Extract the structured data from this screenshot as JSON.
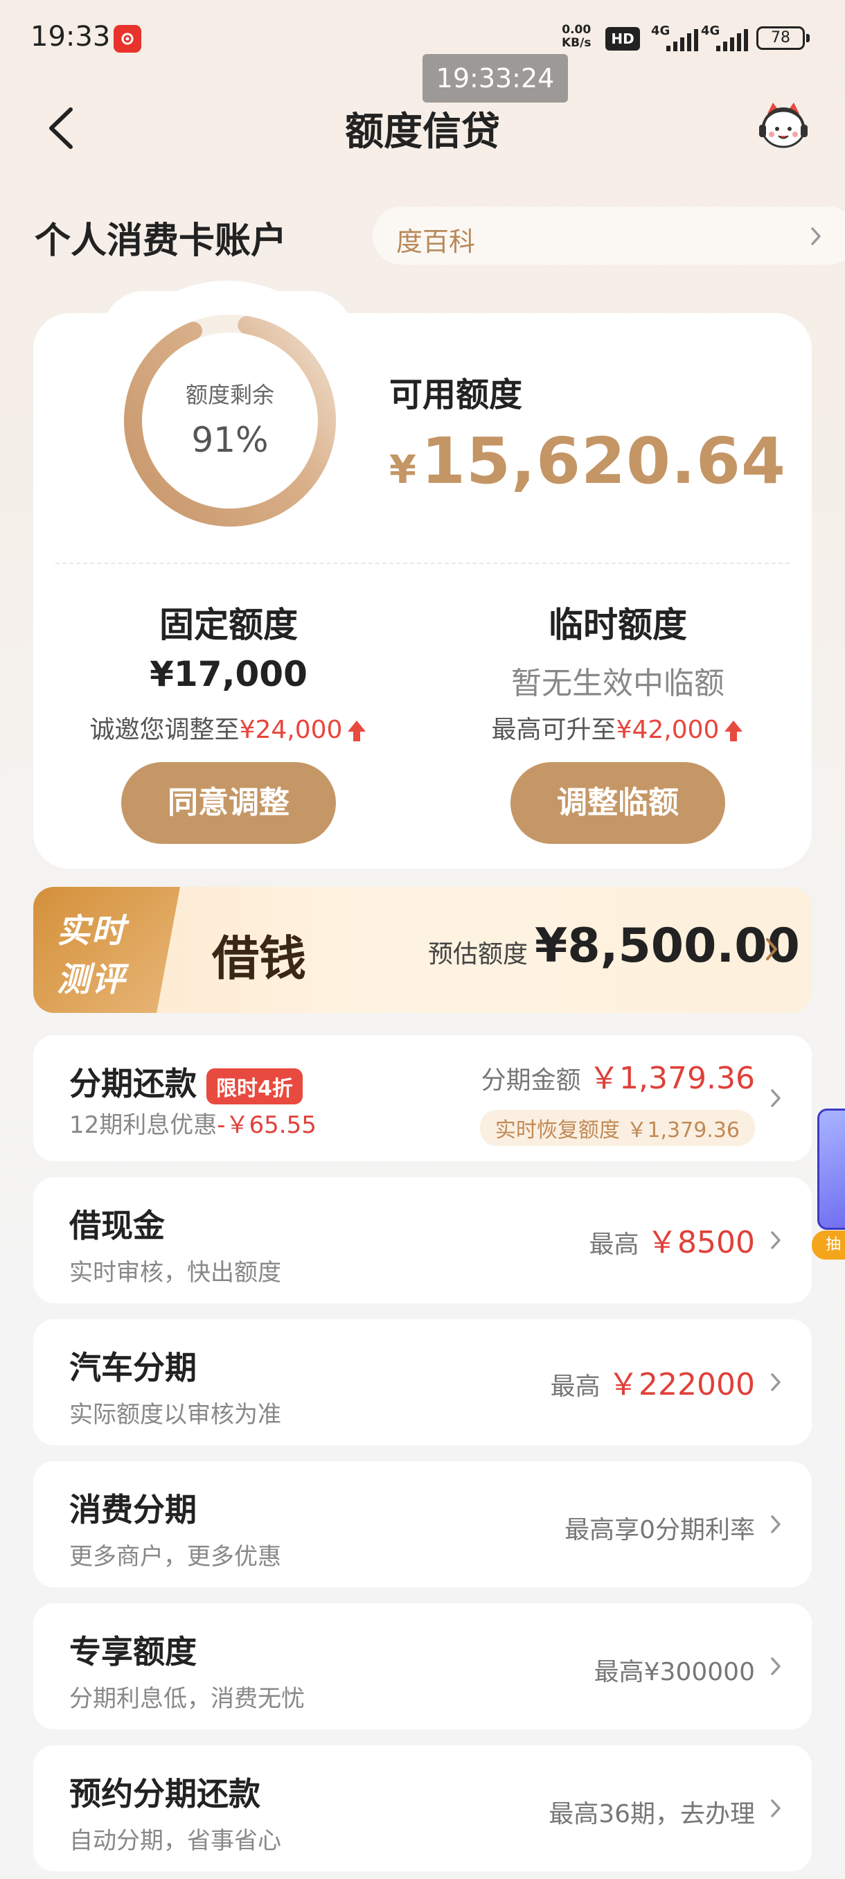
{
  "status_bar": {
    "time": "19:33",
    "net_speed_value": "0.00",
    "net_speed_unit": "KB/s",
    "hd_label": "HD",
    "signal1_label": "4G",
    "signal2_label": "4G",
    "battery": "78"
  },
  "overlay_time": "19:33:24",
  "nav": {
    "title": "额度信贷",
    "back_icon": "chevron-left",
    "service_icon": "mascot-service-icon"
  },
  "account": {
    "title": "个人消费卡账户",
    "link_label": "度百科"
  },
  "credit": {
    "ring_label": "额度剩余",
    "ring_percent_text": "91%",
    "ring_fraction": 0.91,
    "available_label": "可用额度",
    "available_currency": "¥",
    "available_amount": "15,620.64",
    "fixed": {
      "title": "固定额度",
      "value": "¥17,000",
      "sub_prefix": "诚邀您调整至",
      "sub_amount": "¥24,000",
      "button": "同意调整"
    },
    "temp": {
      "title": "临时额度",
      "value": "暂无生效中临额",
      "sub_prefix": "最高可升至",
      "sub_amount": "¥42,000",
      "button": "调整临额"
    }
  },
  "borrow": {
    "tag_line1": "实时",
    "tag_line2": "测评",
    "title": "借钱",
    "estimate_label": "预估额度",
    "estimate_amount": "¥8,500.00"
  },
  "items": [
    {
      "title": "分期还款",
      "badge": "限时4折",
      "sub_prefix": "12期利息优惠",
      "sub_discount": "-￥65.55",
      "right_label": "分期金额",
      "right_value": "￥1,379.36",
      "tag": "实时恢复额度 ￥1,379.36"
    },
    {
      "title": "借现金",
      "sub": "实时审核，快出额度",
      "right_label": "最高",
      "right_value": "￥8500"
    },
    {
      "title": "汽车分期",
      "sub": "实际额度以审核为准",
      "right_label": "最高",
      "right_value": "￥222000"
    },
    {
      "title": "消费分期",
      "sub": "更多商户，更多优惠",
      "right_label": "最高享0分期利率"
    },
    {
      "title": "专享额度",
      "sub": "分期利息低，消费无忧",
      "right_label": "最高¥300000"
    },
    {
      "title": "预约分期还款",
      "sub": "自动分期，省事省心",
      "right_label": "最高36期，去办理"
    }
  ],
  "float_widget": {
    "tag": "抽"
  },
  "colors": {
    "accent": "#c59766",
    "gold_text": "#c49565",
    "red": "#e0403a",
    "bg": "#f5f0ea"
  }
}
